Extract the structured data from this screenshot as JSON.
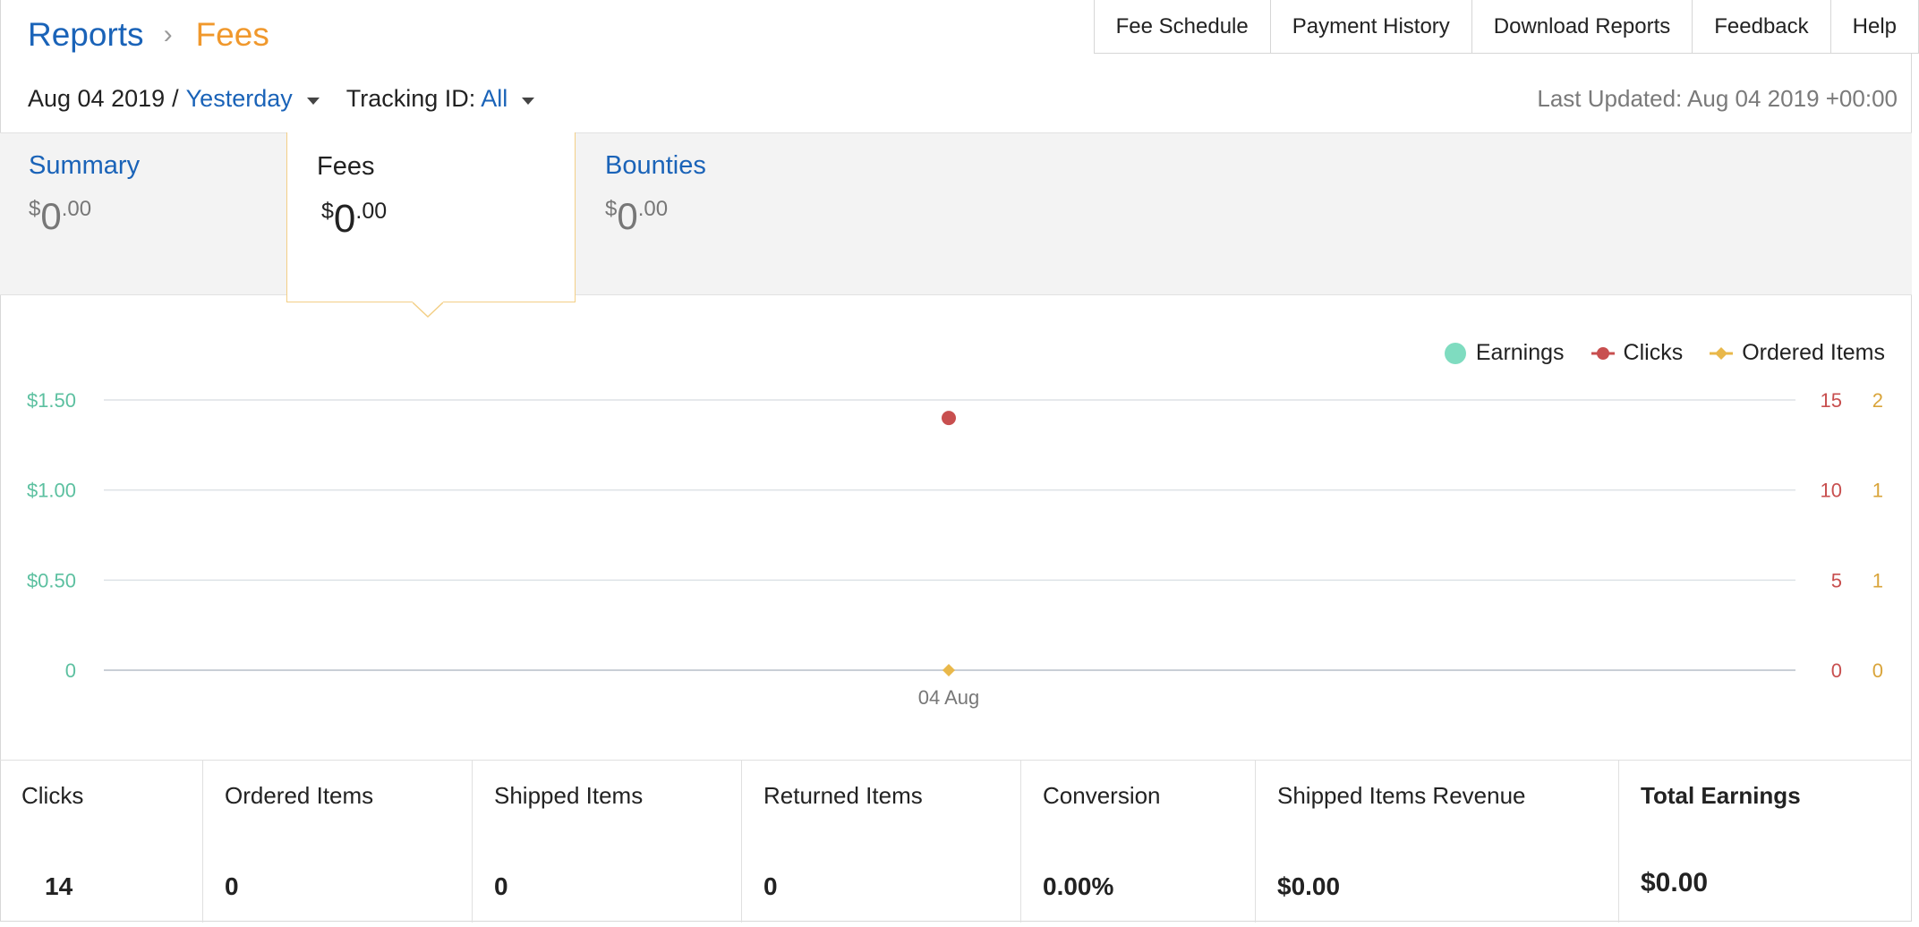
{
  "breadcrumb": {
    "parent": "Reports",
    "separator": "›",
    "current": "Fees"
  },
  "topnav": [
    "Fee Schedule",
    "Payment History",
    "Download Reports",
    "Feedback",
    "Help"
  ],
  "filters": {
    "date": "Aug 04 2019",
    "slash": "/",
    "range": "Yesterday",
    "tracking_label": "Tracking ID:",
    "tracking_value": "All"
  },
  "last_updated": "Last Updated: Aug 04 2019 +00:00",
  "tabs": {
    "summary": {
      "label": "Summary",
      "symbol": "$",
      "whole": "0",
      "cents": ".00"
    },
    "fees": {
      "label": "Fees",
      "symbol": "$",
      "whole": "0",
      "cents": ".00"
    },
    "bounties": {
      "label": "Bounties",
      "symbol": "$",
      "whole": "0",
      "cents": ".00"
    }
  },
  "legend": [
    {
      "name": "Earnings",
      "color": "#7fdcc0",
      "marker": "circle"
    },
    {
      "name": "Clicks",
      "color": "#c84f4f",
      "marker": "circle-line"
    },
    {
      "name": "Ordered Items",
      "color": "#e9b84a",
      "marker": "diamond-line"
    }
  ],
  "chart_data": {
    "type": "scatter",
    "categories": [
      "04 Aug"
    ],
    "axes": {
      "earnings": {
        "ticks": [
          "0",
          "$0.50",
          "$1.00",
          "$1.50"
        ],
        "ylim": [
          0,
          1.5
        ],
        "color": "#5cc0a0"
      },
      "clicks": {
        "ticks": [
          "0",
          "5",
          "10",
          "15"
        ],
        "ylim": [
          0,
          15
        ],
        "color": "#c84f4f"
      },
      "ordered_items": {
        "ticks": [
          "0",
          "1",
          "1",
          "2"
        ],
        "ylim": [
          0,
          2
        ],
        "color": "#d9a43a"
      }
    },
    "series": [
      {
        "name": "Earnings",
        "values": [
          0
        ],
        "color": "#7fdcc0",
        "axis": "earnings"
      },
      {
        "name": "Clicks",
        "values": [
          14
        ],
        "color": "#c84f4f",
        "axis": "clicks"
      },
      {
        "name": "Ordered Items",
        "values": [
          0
        ],
        "color": "#e9b84a",
        "axis": "ordered_items"
      }
    ],
    "grid": true,
    "legend_position": "top-right"
  },
  "stats": [
    {
      "label": "Clicks",
      "value": "14"
    },
    {
      "label": "Ordered Items",
      "value": "0"
    },
    {
      "label": "Shipped Items",
      "value": "0"
    },
    {
      "label": "Returned Items",
      "value": "0"
    },
    {
      "label": "Conversion",
      "value": "0.00%"
    },
    {
      "label": "Shipped Items Revenue",
      "value": "$0.00"
    },
    {
      "label": "Total Earnings",
      "value": "$0.00"
    }
  ]
}
